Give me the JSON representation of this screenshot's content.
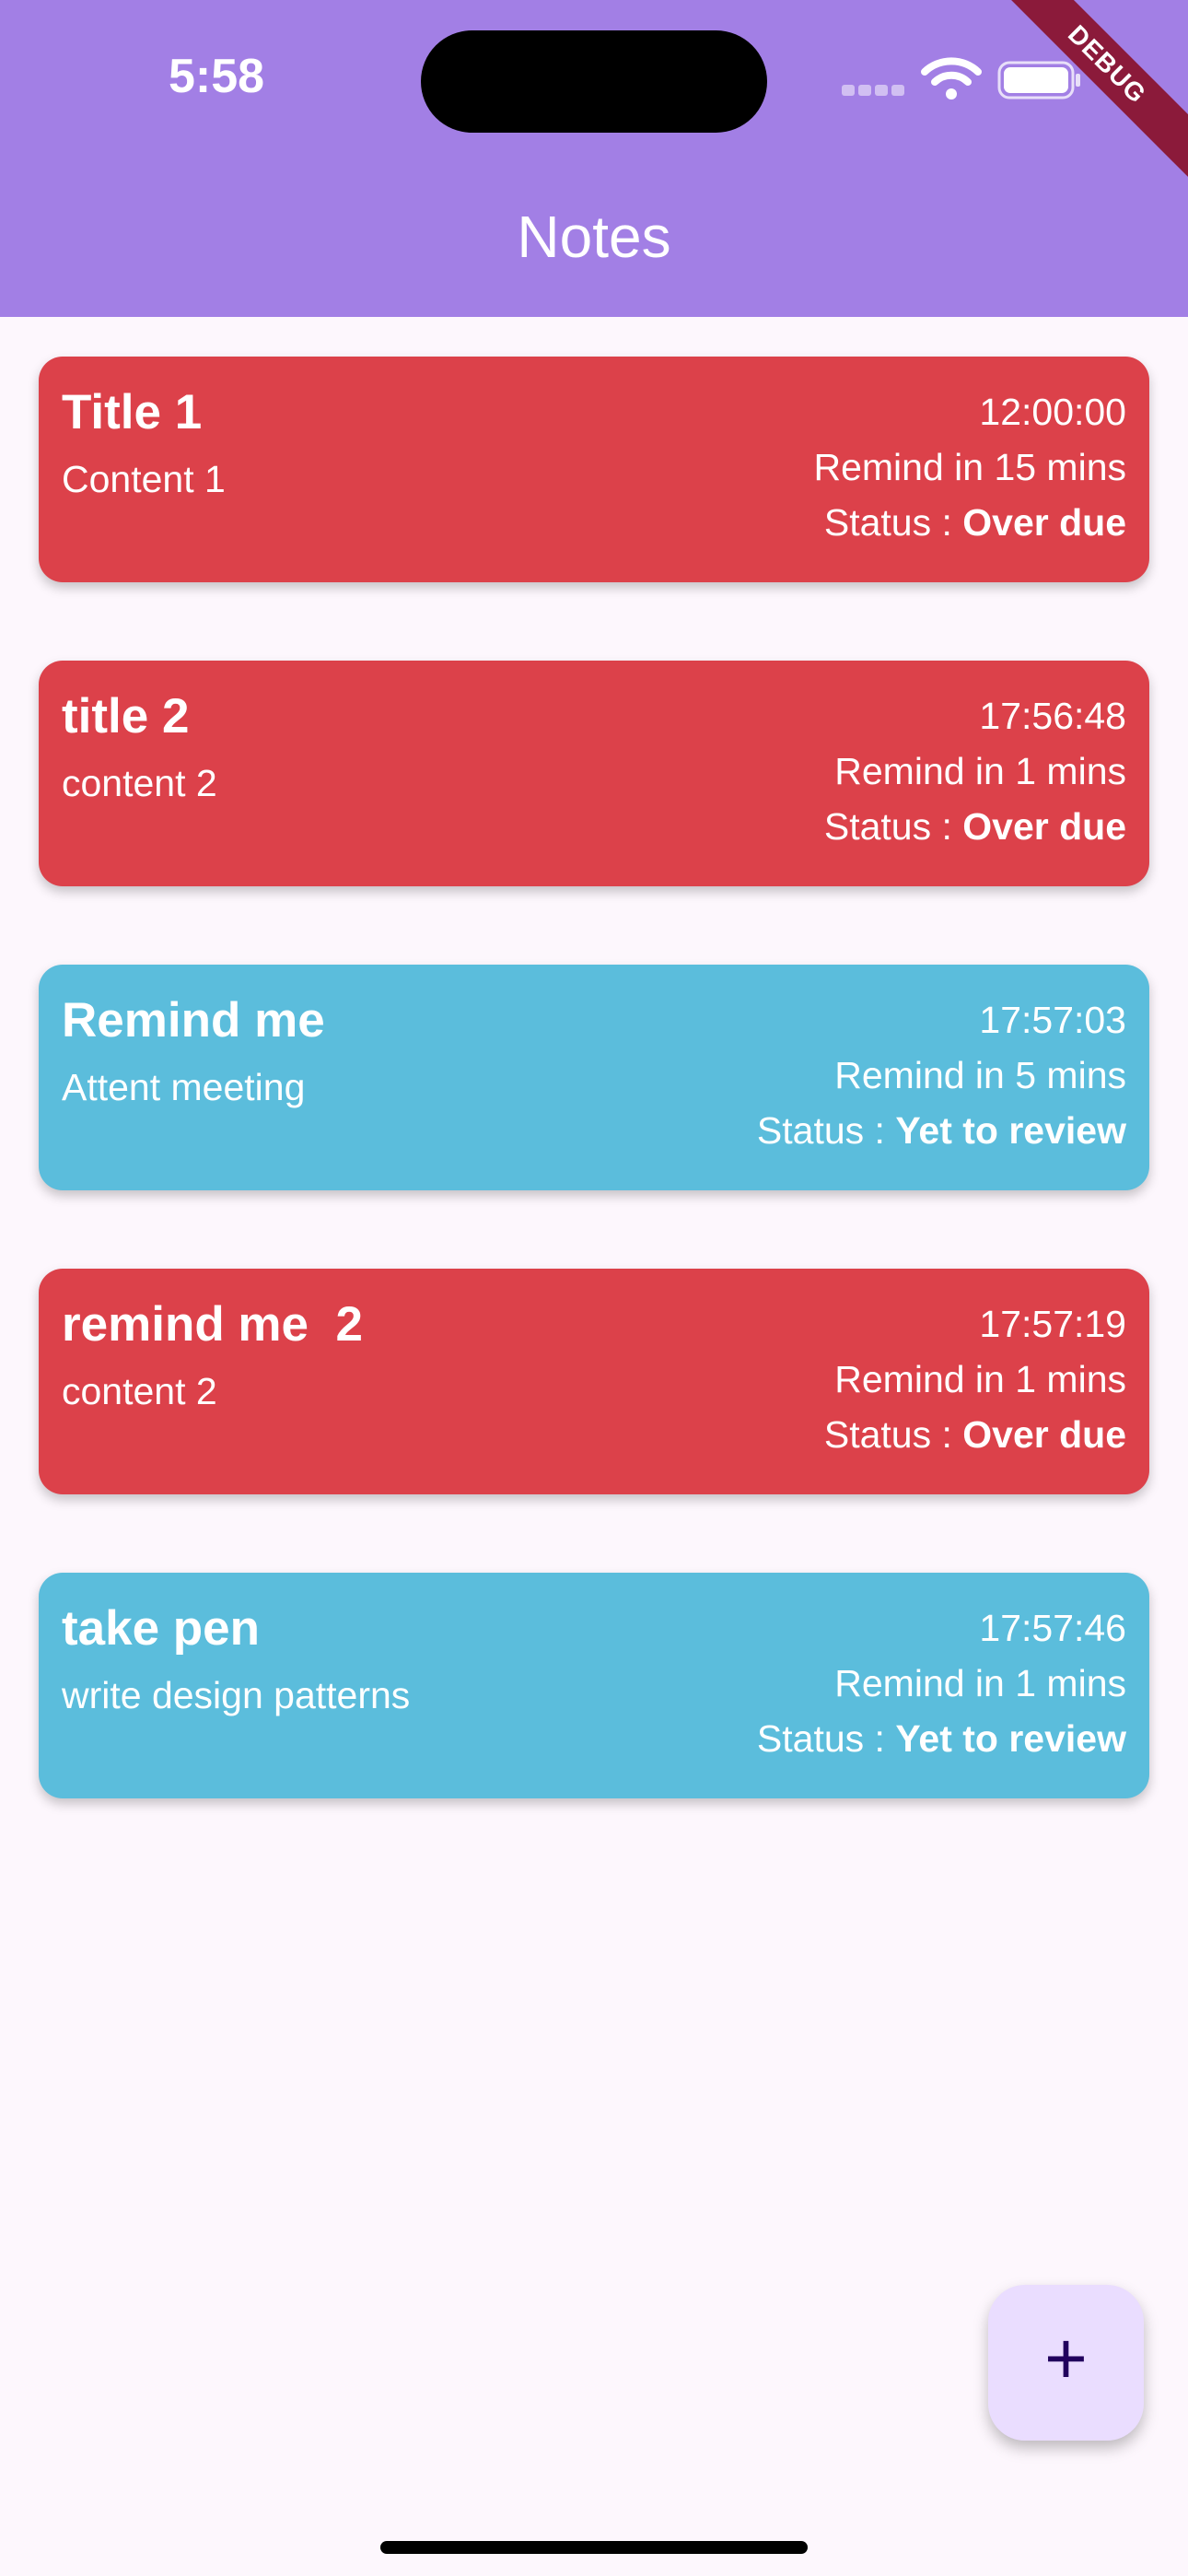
{
  "status_bar": {
    "time": "5:58",
    "debug_label": "DEBUG"
  },
  "app_bar": {
    "title": "Notes"
  },
  "notes": [
    {
      "title": "Title 1",
      "content": "Content 1",
      "time": "12:00:00",
      "remind": "Remind in 15 mins",
      "status_prefix": "Status : ",
      "status": "Over due",
      "color": "#DC414A"
    },
    {
      "title": "title 2",
      "content": "content 2",
      "time": "17:56:48",
      "remind": "Remind in 1 mins",
      "status_prefix": "Status : ",
      "status": "Over due",
      "color": "#DC414A"
    },
    {
      "title": "Remind me",
      "content": "Attent meeting",
      "time": "17:57:03",
      "remind": "Remind in 5 mins",
      "status_prefix": "Status : ",
      "status": "Yet to review",
      "color": "#5BBDDC"
    },
    {
      "title": "remind me  2",
      "content": "content 2",
      "time": "17:57:19",
      "remind": "Remind in 1 mins",
      "status_prefix": "Status : ",
      "status": "Over due",
      "color": "#DC414A"
    },
    {
      "title": "take pen",
      "content": "write design patterns",
      "time": "17:57:46",
      "remind": "Remind in 1 mins",
      "status_prefix": "Status : ",
      "status": "Yet to review",
      "color": "#5BBDDC"
    }
  ],
  "fab": {
    "label": "+",
    "icon": "add-icon"
  },
  "colors": {
    "app_bar": "#A27FE5",
    "background": "#FDF7FD",
    "overdue": "#DC414A",
    "yet_to_review": "#5BBDDC",
    "fab_bg": "#EADDFF"
  }
}
